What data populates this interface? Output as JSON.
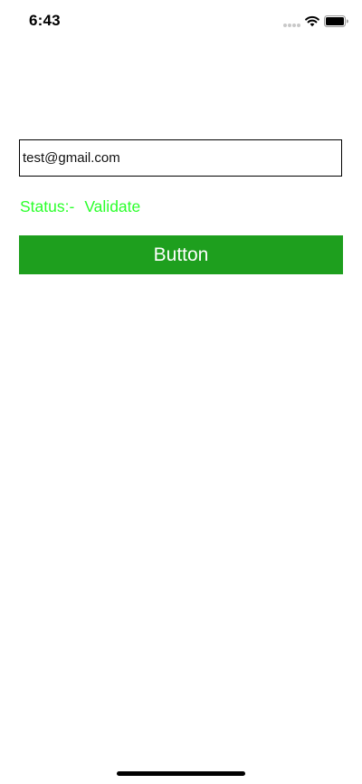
{
  "status_bar": {
    "time": "6:43",
    "icons": [
      "signal-dots-icon",
      "wifi-icon",
      "battery-icon"
    ]
  },
  "form": {
    "email_value": "test@gmail.com",
    "status_label": "Status:-",
    "status_value": "Validate",
    "button_label": "Button"
  },
  "colors": {
    "status_text": "#2bff2b",
    "button_background": "#1e9f1e",
    "button_text": "#ffffff",
    "field_border": "#000000"
  }
}
